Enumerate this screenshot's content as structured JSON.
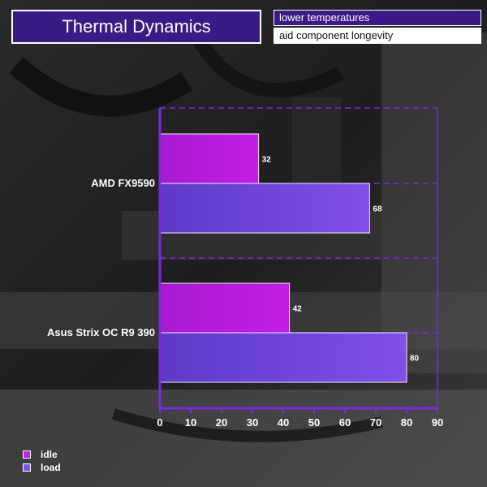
{
  "header": {
    "title": "Thermal Dynamics",
    "tag_primary": "lower temperatures",
    "tag_secondary": "aid component longevity"
  },
  "colors": {
    "idle": "#c41ee6",
    "load": "#8050e8",
    "axis": "#7a2ae0",
    "header_bg": "#3b1a86"
  },
  "chart_data": {
    "type": "bar",
    "orientation": "horizontal",
    "categories": [
      "AMD FX9590",
      "Asus Strix OC R9 390"
    ],
    "series": [
      {
        "name": "idle",
        "values": [
          32,
          42
        ]
      },
      {
        "name": "load",
        "values": [
          68,
          80
        ]
      }
    ],
    "xlim": [
      0,
      90
    ],
    "xticks": [
      0,
      10,
      20,
      30,
      40,
      50,
      60,
      70,
      80,
      90
    ],
    "grid": true,
    "legend_position": "bottom-left"
  }
}
